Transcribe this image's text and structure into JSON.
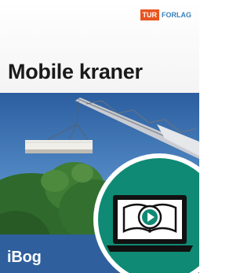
{
  "publisher": {
    "prefix": "TUR",
    "suffix": "FORLAG",
    "prefix_color": "#e8541f",
    "suffix_color": "#3a7fb8"
  },
  "title": "Mobile kraner",
  "brand": "iBog",
  "icons": {
    "video_book": "laptop-with-book-and-play-icon"
  },
  "colors": {
    "teal": "#0f8a74",
    "blue": "#2f5f9c"
  }
}
